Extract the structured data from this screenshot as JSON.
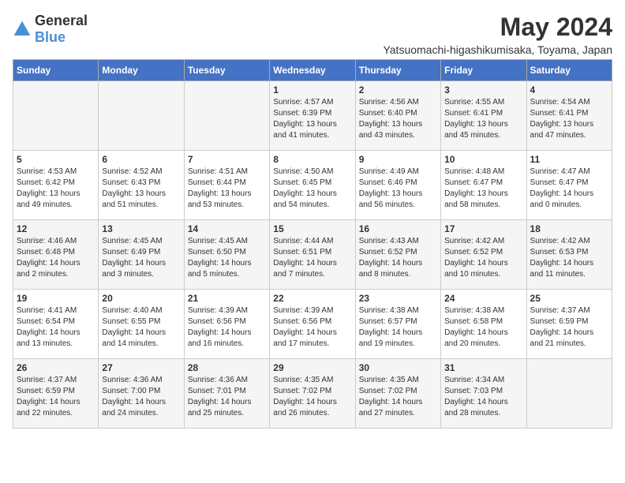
{
  "header": {
    "logo_general": "General",
    "logo_blue": "Blue",
    "month_title": "May 2024",
    "location": "Yatsuomachi-higashikumisaka, Toyama, Japan"
  },
  "days_of_week": [
    "Sunday",
    "Monday",
    "Tuesday",
    "Wednesday",
    "Thursday",
    "Friday",
    "Saturday"
  ],
  "weeks": [
    [
      null,
      null,
      null,
      {
        "day": "1",
        "sunrise": "4:57 AM",
        "sunset": "6:39 PM",
        "daylight": "13 hours and 41 minutes."
      },
      {
        "day": "2",
        "sunrise": "4:56 AM",
        "sunset": "6:40 PM",
        "daylight": "13 hours and 43 minutes."
      },
      {
        "day": "3",
        "sunrise": "4:55 AM",
        "sunset": "6:41 PM",
        "daylight": "13 hours and 45 minutes."
      },
      {
        "day": "4",
        "sunrise": "4:54 AM",
        "sunset": "6:41 PM",
        "daylight": "13 hours and 47 minutes."
      }
    ],
    [
      {
        "day": "5",
        "sunrise": "4:53 AM",
        "sunset": "6:42 PM",
        "daylight": "13 hours and 49 minutes."
      },
      {
        "day": "6",
        "sunrise": "4:52 AM",
        "sunset": "6:43 PM",
        "daylight": "13 hours and 51 minutes."
      },
      {
        "day": "7",
        "sunrise": "4:51 AM",
        "sunset": "6:44 PM",
        "daylight": "13 hours and 53 minutes."
      },
      {
        "day": "8",
        "sunrise": "4:50 AM",
        "sunset": "6:45 PM",
        "daylight": "13 hours and 54 minutes."
      },
      {
        "day": "9",
        "sunrise": "4:49 AM",
        "sunset": "6:46 PM",
        "daylight": "13 hours and 56 minutes."
      },
      {
        "day": "10",
        "sunrise": "4:48 AM",
        "sunset": "6:47 PM",
        "daylight": "13 hours and 58 minutes."
      },
      {
        "day": "11",
        "sunrise": "4:47 AM",
        "sunset": "6:47 PM",
        "daylight": "14 hours and 0 minutes."
      }
    ],
    [
      {
        "day": "12",
        "sunrise": "4:46 AM",
        "sunset": "6:48 PM",
        "daylight": "14 hours and 2 minutes."
      },
      {
        "day": "13",
        "sunrise": "4:45 AM",
        "sunset": "6:49 PM",
        "daylight": "14 hours and 3 minutes."
      },
      {
        "day": "14",
        "sunrise": "4:45 AM",
        "sunset": "6:50 PM",
        "daylight": "14 hours and 5 minutes."
      },
      {
        "day": "15",
        "sunrise": "4:44 AM",
        "sunset": "6:51 PM",
        "daylight": "14 hours and 7 minutes."
      },
      {
        "day": "16",
        "sunrise": "4:43 AM",
        "sunset": "6:52 PM",
        "daylight": "14 hours and 8 minutes."
      },
      {
        "day": "17",
        "sunrise": "4:42 AM",
        "sunset": "6:52 PM",
        "daylight": "14 hours and 10 minutes."
      },
      {
        "day": "18",
        "sunrise": "4:42 AM",
        "sunset": "6:53 PM",
        "daylight": "14 hours and 11 minutes."
      }
    ],
    [
      {
        "day": "19",
        "sunrise": "4:41 AM",
        "sunset": "6:54 PM",
        "daylight": "14 hours and 13 minutes."
      },
      {
        "day": "20",
        "sunrise": "4:40 AM",
        "sunset": "6:55 PM",
        "daylight": "14 hours and 14 minutes."
      },
      {
        "day": "21",
        "sunrise": "4:39 AM",
        "sunset": "6:56 PM",
        "daylight": "14 hours and 16 minutes."
      },
      {
        "day": "22",
        "sunrise": "4:39 AM",
        "sunset": "6:56 PM",
        "daylight": "14 hours and 17 minutes."
      },
      {
        "day": "23",
        "sunrise": "4:38 AM",
        "sunset": "6:57 PM",
        "daylight": "14 hours and 19 minutes."
      },
      {
        "day": "24",
        "sunrise": "4:38 AM",
        "sunset": "6:58 PM",
        "daylight": "14 hours and 20 minutes."
      },
      {
        "day": "25",
        "sunrise": "4:37 AM",
        "sunset": "6:59 PM",
        "daylight": "14 hours and 21 minutes."
      }
    ],
    [
      {
        "day": "26",
        "sunrise": "4:37 AM",
        "sunset": "6:59 PM",
        "daylight": "14 hours and 22 minutes."
      },
      {
        "day": "27",
        "sunrise": "4:36 AM",
        "sunset": "7:00 PM",
        "daylight": "14 hours and 24 minutes."
      },
      {
        "day": "28",
        "sunrise": "4:36 AM",
        "sunset": "7:01 PM",
        "daylight": "14 hours and 25 minutes."
      },
      {
        "day": "29",
        "sunrise": "4:35 AM",
        "sunset": "7:02 PM",
        "daylight": "14 hours and 26 minutes."
      },
      {
        "day": "30",
        "sunrise": "4:35 AM",
        "sunset": "7:02 PM",
        "daylight": "14 hours and 27 minutes."
      },
      {
        "day": "31",
        "sunrise": "4:34 AM",
        "sunset": "7:03 PM",
        "daylight": "14 hours and 28 minutes."
      },
      null
    ]
  ]
}
